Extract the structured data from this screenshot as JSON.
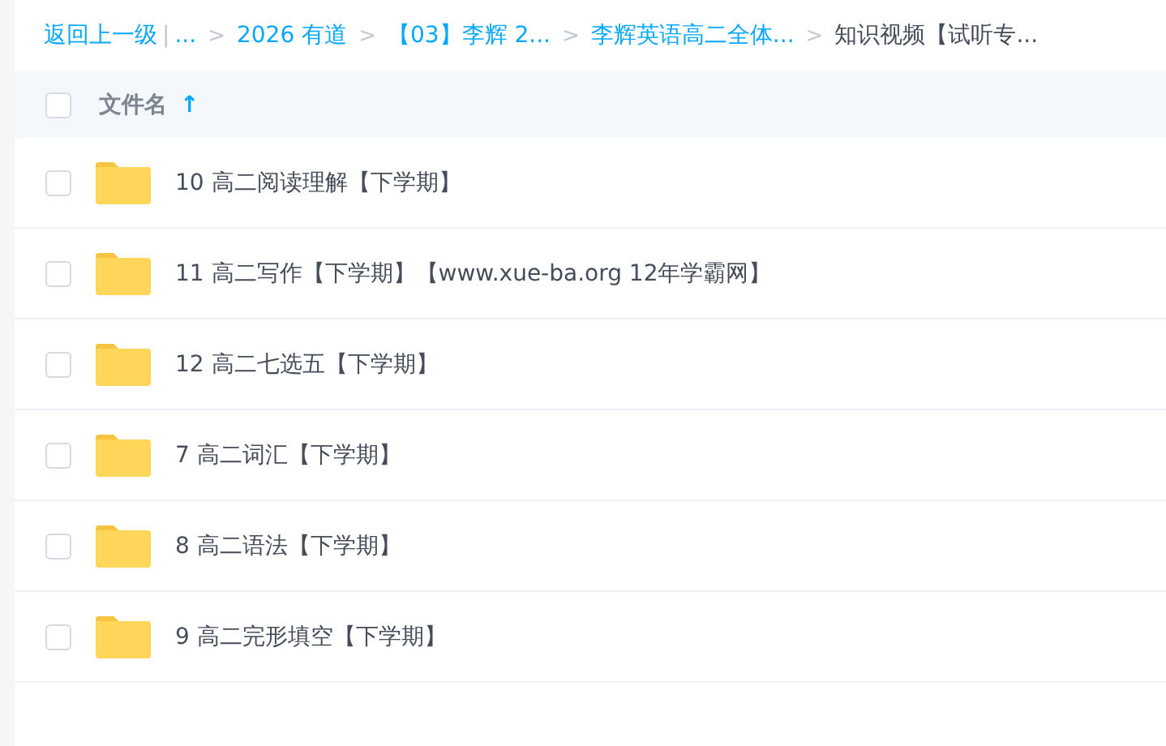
{
  "breadcrumb": {
    "back": "返回上一级",
    "divider": "|",
    "items": [
      {
        "label": "...",
        "kind": "link",
        "separator": ">"
      },
      {
        "label": "2026 有道",
        "kind": "link",
        "separator": ">"
      },
      {
        "label": "【03】李辉 2...",
        "kind": "link",
        "separator": ">"
      },
      {
        "label": "李辉英语高二全体...",
        "kind": "link",
        "separator": ">"
      },
      {
        "label": "知识视频【试听专...",
        "kind": "current"
      }
    ]
  },
  "header": {
    "checked": false,
    "label": "文件名",
    "sort_arrow": "↑"
  },
  "rows": [
    {
      "name": "10 高二阅读理解【下学期】",
      "kind": "folder",
      "checked": false
    },
    {
      "name": "11 高二写作【下学期】【www.xue-ba.org 12年学霸网】",
      "kind": "folder",
      "checked": false
    },
    {
      "name": "12 高二七选五【下学期】",
      "kind": "folder",
      "checked": false
    },
    {
      "name": "7 高二词汇【下学期】",
      "kind": "folder",
      "checked": false
    },
    {
      "name": "8 高二语法【下学期】",
      "kind": "folder",
      "checked": false
    },
    {
      "name": "9 高二完形填空【下学期】",
      "kind": "folder",
      "checked": false
    }
  ]
}
